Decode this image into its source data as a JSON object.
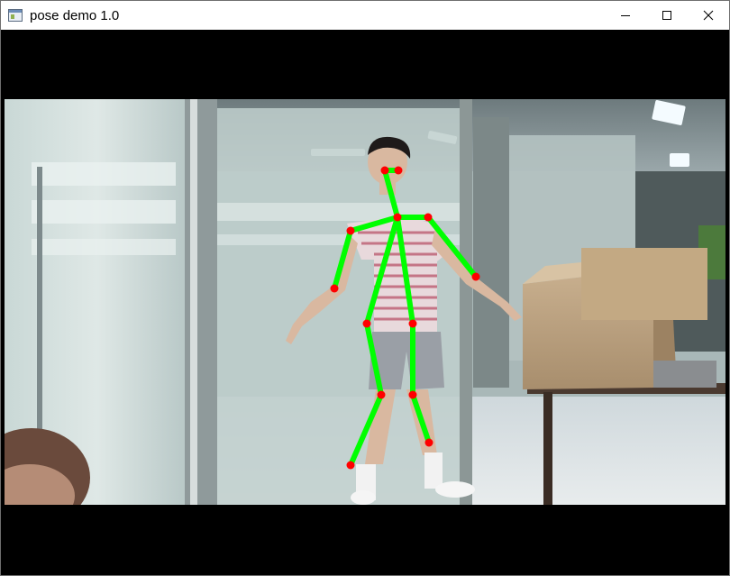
{
  "window": {
    "title": "pose demo 1.0",
    "icon": "app-window-icon",
    "controls": [
      "minimize-icon",
      "maximize-icon",
      "close-icon"
    ]
  },
  "overlay": {
    "limb_color": "#00ff00",
    "joint_color": "#ff0000"
  }
}
